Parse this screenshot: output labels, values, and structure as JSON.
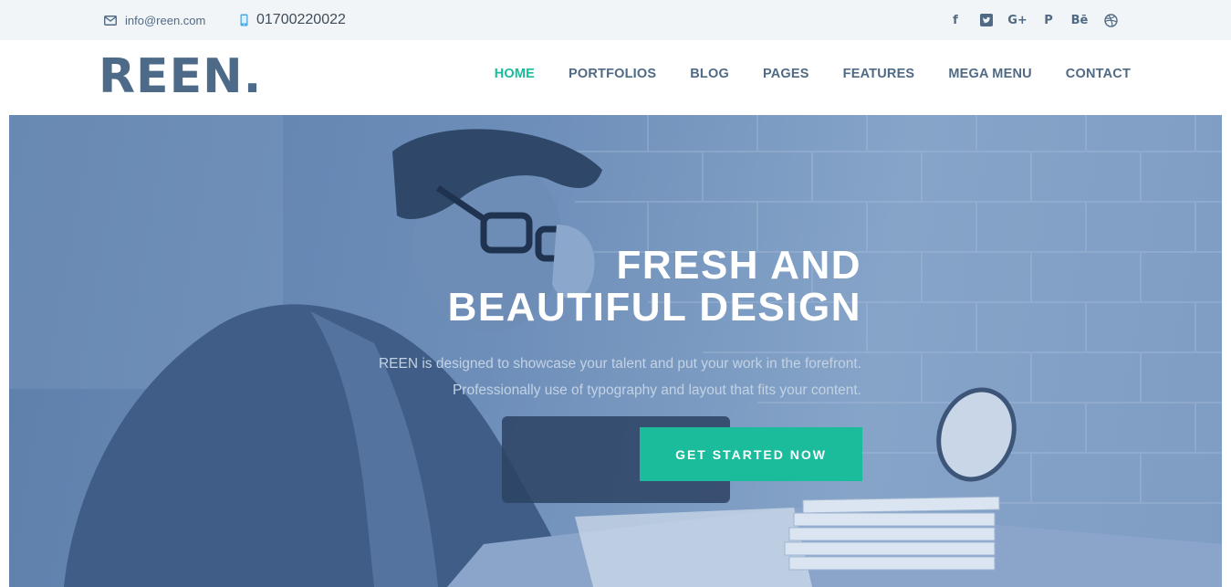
{
  "topbar": {
    "email": "info@reen.com",
    "phone": "01700220022",
    "email_icon": "envelope-icon",
    "phone_icon": "mobile-phone-icon",
    "social": [
      {
        "name": "facebook-icon",
        "glyph": "f"
      },
      {
        "name": "twitter-icon",
        "glyph": ""
      },
      {
        "name": "google-plus-icon",
        "glyph": "G+"
      },
      {
        "name": "pinterest-icon",
        "glyph": "P"
      },
      {
        "name": "behance-icon",
        "glyph": "Bē"
      },
      {
        "name": "dribbble-icon",
        "glyph": ""
      }
    ]
  },
  "header": {
    "logo": "REEN.",
    "nav": [
      {
        "label": "HOME",
        "active": true
      },
      {
        "label": "PORTFOLIOS",
        "active": false
      },
      {
        "label": "BLOG",
        "active": false
      },
      {
        "label": "PAGES",
        "active": false
      },
      {
        "label": "FEATURES",
        "active": false
      },
      {
        "label": "MEGA MENU",
        "active": false
      },
      {
        "label": "CONTACT",
        "active": false
      }
    ]
  },
  "hero": {
    "title_line1": "FRESH AND",
    "title_line2": "BEAUTIFUL DESIGN",
    "text_line1": "REEN is designed to showcase your talent and put your work in the forefront.",
    "text_line2": "Professionally use of typography and layout that fits your content.",
    "cta_label": "GET STARTED NOW"
  },
  "colors": {
    "accent": "#1abc9c",
    "brand": "#4e6a89",
    "topbar_bg": "#f2f5f7",
    "hero_tint": "#7390b8"
  }
}
